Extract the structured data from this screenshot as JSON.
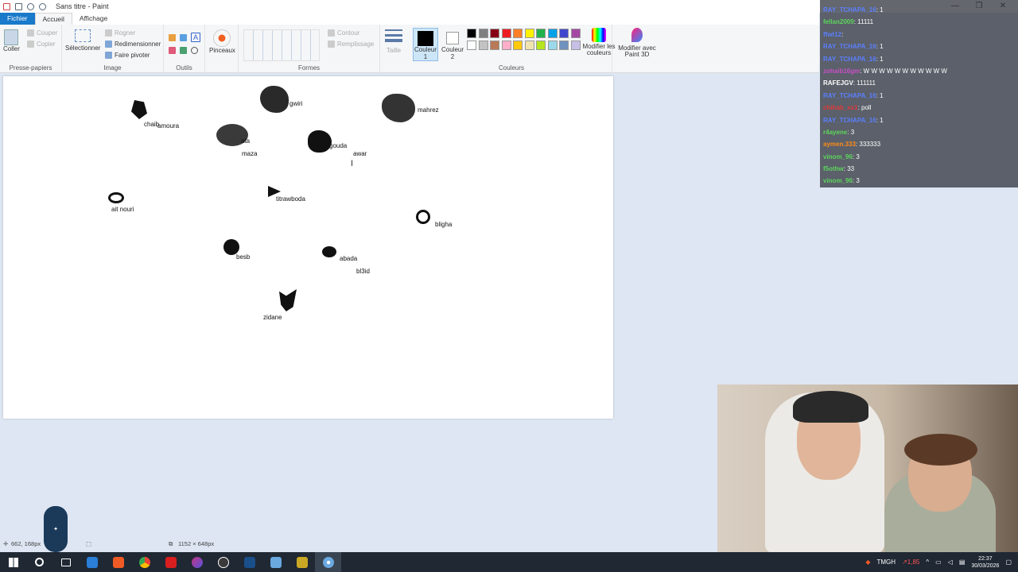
{
  "window": {
    "title": "Sans titre - Paint",
    "minimize": "—",
    "maximize": "❐",
    "close": "✕"
  },
  "tabs": [
    "Fichier",
    "Accueil",
    "Affichage"
  ],
  "ribbon": {
    "clipboard": {
      "paste": "Coller",
      "cut": "Couper",
      "copy": "Copier",
      "label": "Presse-papiers"
    },
    "image": {
      "select": "Sélectionner",
      "crop": "Rogner",
      "resize": "Redimensionner",
      "rotate": "Faire pivoter",
      "label": "Image"
    },
    "tools": {
      "label": "Outils"
    },
    "brushes": {
      "label": "Pinceaux"
    },
    "shapes": {
      "outline": "Contour",
      "fill": "Remplissage",
      "label": "Formes"
    },
    "size": {
      "label": "Taille"
    },
    "colors": {
      "color1": "Couleur 1",
      "color2": "Couleur 2",
      "edit": "Modifier les couleurs",
      "paint3d": "Modifier avec Paint 3D",
      "label": "Couleurs",
      "palette_row1": [
        "#000000",
        "#7f7f7f",
        "#880015",
        "#ed1c24",
        "#ff7f27",
        "#fff200",
        "#22b14c",
        "#00a2e8",
        "#3f48cc",
        "#a349a4"
      ],
      "palette_row2": [
        "#ffffff",
        "#c3c3c3",
        "#b97a57",
        "#ffaec9",
        "#ffc90e",
        "#efe4b0",
        "#b5e61d",
        "#99d9ea",
        "#7092be",
        "#c8bfe7"
      ]
    }
  },
  "canvas_labels": [
    "chaib",
    "amoura",
    "gwiri",
    "mahrez",
    "ata",
    "maza",
    "gouda",
    "awar",
    "ait nouri",
    "titrawboda",
    "bligha",
    "besb",
    "abada",
    "bl3id",
    "zidane"
  ],
  "chat": [
    {
      "user": "RAY_TCHAPA_16",
      "msg": ": 1",
      "color": "#5b7fff"
    },
    {
      "user": "fellan2009",
      "msg": ": 11111",
      "color": "#5cd65c"
    },
    {
      "user": "ffwt12",
      "msg": ": ",
      "color": "#5b7fff"
    },
    {
      "user": "RAY_TCHAPA_16",
      "msg": ": 1",
      "color": "#5b7fff"
    },
    {
      "user": "RAY_TCHAPA_16",
      "msg": ": 1",
      "color": "#5b7fff"
    },
    {
      "user": "zohaib16gm",
      "msg": ": W W W W W W W W W W W",
      "color": "#c850c8"
    },
    {
      "user": "RAFEJGV",
      "msg": ": 111111",
      "color": "#ffffff"
    },
    {
      "user": "RAY_TCHAPA_16",
      "msg": ": 1",
      "color": "#5b7fff"
    },
    {
      "user": "chihab_xx1",
      "msg": ": poll",
      "color": "#e03a3a"
    },
    {
      "user": "RAY_TCHAPA_16",
      "msg": ": 1",
      "color": "#5b7fff"
    },
    {
      "user": "r4ayene",
      "msg": ": 3",
      "color": "#5cd65c"
    },
    {
      "user": "aymen.333",
      "msg": ": 333333",
      "color": "#ff8c1a"
    },
    {
      "user": "vinom_96",
      "msg": ": 3",
      "color": "#5cd65c"
    },
    {
      "user": "f5othw",
      "msg": ": 33",
      "color": "#5cd65c"
    },
    {
      "user": "vinom_96",
      "msg": ": 3",
      "color": "#5cd65c"
    }
  ],
  "status": {
    "cursor_pos": "662, 168px",
    "canvas_size": "1152 × 648px"
  },
  "taskbar": {
    "tray_app": "TMGH",
    "tray_value": "↗1,85",
    "time": "22:37",
    "date": "30/03/2026"
  }
}
